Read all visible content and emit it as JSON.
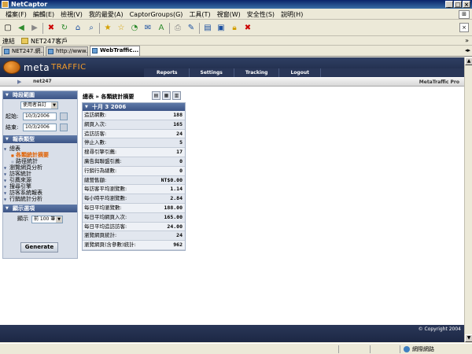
{
  "window": {
    "title": "NetCaptor"
  },
  "menu": {
    "items": [
      "檔案(F)",
      "編輯(E)",
      "檢視(V)",
      "我的最愛(A)",
      "CaptorGroups(G)",
      "工具(T)",
      "視窗(W)",
      "安全性(S)",
      "說明(H)"
    ]
  },
  "linksbar": {
    "label": "連結",
    "link1": "NET247客戶"
  },
  "browser_tabs": [
    {
      "label": "NET247.網..."
    },
    {
      "label": "http://www..."
    },
    {
      "label": "WebTraffic..."
    }
  ],
  "site": {
    "brand_meta": "meta",
    "brand_traffic": "TRAFFIC",
    "nav": [
      "Reports",
      "Settings",
      "Tracking",
      "Logout"
    ],
    "account": "net247",
    "product": "MetaTraffic Pro",
    "copyright": "© Copyright 2004"
  },
  "left": {
    "section_date": "時段範圍",
    "range_select": "使用者自訂",
    "start_label": "起始:",
    "start_value": "10/3/2006",
    "end_label": "結束:",
    "end_value": "10/3/2006",
    "section_report": "報表類型",
    "nav": [
      {
        "label": "總表",
        "level": 0
      },
      {
        "label": "各類統計摘要",
        "level": 1,
        "active": true
      },
      {
        "label": "路徑統計",
        "level": 1
      },
      {
        "label": "瀏覽網頁分析",
        "level": 0
      },
      {
        "label": "訪客統計",
        "level": 0
      },
      {
        "label": "引薦來源",
        "level": 0
      },
      {
        "label": "搜尋引擎",
        "level": 0
      },
      {
        "label": "訪客系統報表",
        "level": 0
      },
      {
        "label": "行銷統計分析",
        "level": 0
      }
    ],
    "section_display": "顯示選項",
    "display_label": "顯示",
    "display_select": "前 100 筆",
    "generate": "Generate"
  },
  "report": {
    "title": "總表 » 各類統計摘要",
    "date_header": "十月 3 2006",
    "rows": [
      {
        "label": "造訪網數:",
        "value": "188"
      },
      {
        "label": "網頁入次:",
        "value": "165"
      },
      {
        "label": "造訪訪客:",
        "value": "24"
      },
      {
        "label": "停止入數:",
        "value": "5"
      },
      {
        "label": "搜尋引擎引薦:",
        "value": "17"
      },
      {
        "label": "廣告與聯盟引薦:",
        "value": "0"
      },
      {
        "label": "行銷行為總數:",
        "value": "0"
      },
      {
        "label": "總營售額:",
        "value": "NT$0.00"
      },
      {
        "label": "每訪客平均瀏覽數:",
        "value": "1.14"
      },
      {
        "label": "每小時平均瀏覽數:",
        "value": "2.84"
      },
      {
        "label": "每日平均瀏覽數:",
        "value": "188.00"
      },
      {
        "label": "每日平均網頁入次:",
        "value": "165.00"
      },
      {
        "label": "每日平均造訪訪客:",
        "value": "24.00"
      },
      {
        "label": "瀏覽網頁統計:",
        "value": "24"
      },
      {
        "label": "瀏覽網頁(含參數)統計:",
        "value": "962"
      }
    ]
  },
  "status": {
    "zone": "網際網路"
  }
}
